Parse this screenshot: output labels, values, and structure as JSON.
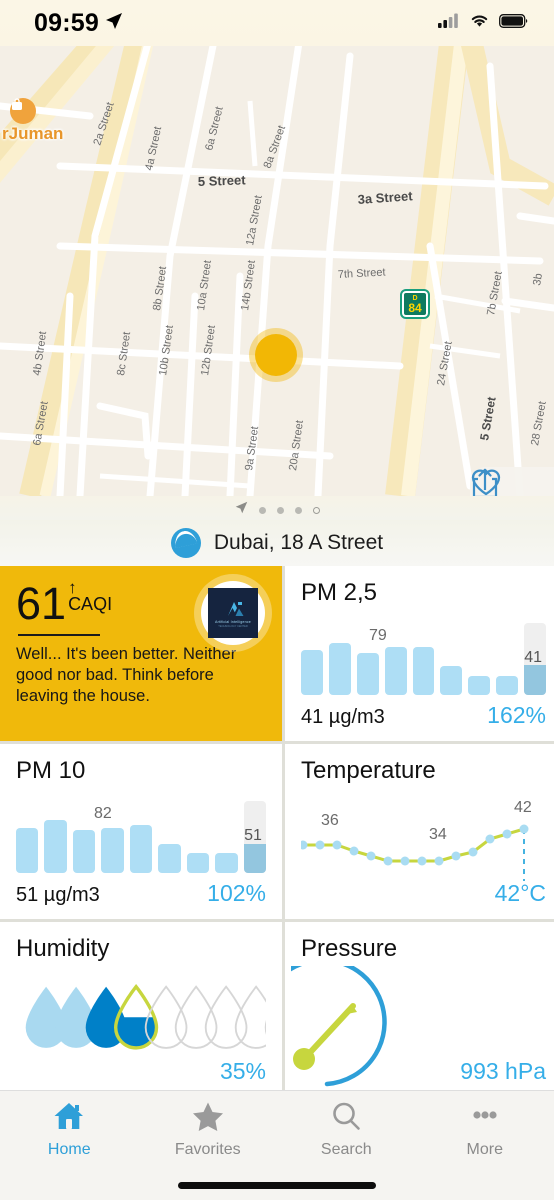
{
  "status_bar": {
    "time": "09:59",
    "location_arrow_icon": "location-arrow-icon",
    "signal_icon": "cellular-signal-icon",
    "wifi_icon": "wifi-icon",
    "battery_icon": "battery-full-icon"
  },
  "map": {
    "poi_label": "rJuman",
    "poi_icon": "shopping-bag-icon",
    "highway_shield": {
      "prefix": "D",
      "number": "84"
    },
    "street_labels": [
      "2a Street",
      "4a Street",
      "5 Street",
      "6a Street",
      "8a Street",
      "3a Street",
      "12a Street",
      "7th Street",
      "8b Street",
      "10a Street",
      "14b Street",
      "4b Street",
      "8c Street",
      "10b Street",
      "12b Street",
      "6a Street",
      "9a Street",
      "20a Street",
      "24 Street",
      "5 Street",
      "7b Street",
      "5 Street",
      "28 Street",
      "3b"
    ],
    "share_icon": "share-icon",
    "favorite_icon": "heart-icon",
    "marker_color": "#F2B705"
  },
  "pager": {
    "arrow_icon": "location-arrow-icon",
    "dots": [
      "filled",
      "filled",
      "filled",
      "hollow"
    ]
  },
  "location": {
    "icon": "air-quality-globe-icon",
    "name": "Dubai, 18 A Street"
  },
  "cards": {
    "caqi": {
      "value": "61",
      "trend_arrow": "↑",
      "unit_label": "CAQI",
      "message": "Well... It's been better. Neither good nor bad. Think before leaving the house.",
      "background_color": "#F0B90B",
      "avatar_name": "Artificial Intelligence",
      "avatar_sub": "TECHNOLOGY CENTER"
    },
    "pm25": {
      "title": "PM 2,5",
      "value": "41 µg/m3",
      "percent": "162%",
      "peak_label": "79",
      "current_label": "41"
    },
    "pm10": {
      "title": "PM 10",
      "value": "51 µg/m3",
      "percent": "102%",
      "peak_label": "82",
      "current_label": "51"
    },
    "temperature": {
      "title": "Temperature",
      "value": "42°C",
      "labels": [
        "36",
        "34",
        "42"
      ]
    },
    "humidity": {
      "title": "Humidity",
      "percent": "35%"
    },
    "pressure": {
      "title": "Pressure",
      "value": "993 hPa"
    }
  },
  "chart_data": [
    {
      "type": "bar",
      "title": "PM 2,5",
      "ylabel": "µg/m3",
      "values": [
        62,
        72,
        58,
        66,
        66,
        40,
        26,
        26,
        41
      ],
      "peak_value": 79,
      "current_value": 41,
      "ylim": [
        0,
        100
      ],
      "annotations": [
        "79",
        "41"
      ],
      "legend": "",
      "grid": false
    },
    {
      "type": "bar",
      "title": "PM 10",
      "ylabel": "µg/m3",
      "values": [
        62,
        74,
        60,
        62,
        66,
        40,
        28,
        28,
        51
      ],
      "peak_value": 82,
      "current_value": 51,
      "ylim": [
        0,
        100
      ],
      "annotations": [
        "82",
        "51"
      ],
      "legend": "",
      "grid": false
    },
    {
      "type": "line",
      "title": "Temperature",
      "ylabel": "°C",
      "values": [
        36,
        36,
        36,
        35,
        34.5,
        34,
        34,
        34,
        34,
        34.5,
        35.5,
        36,
        38,
        40,
        42
      ],
      "annotations": [
        "36",
        "34",
        "42"
      ],
      "current_value": 42,
      "ylim": [
        33,
        43
      ],
      "grid": false
    },
    {
      "type": "bar",
      "title": "Humidity",
      "ylabel": "%",
      "categories": [
        "1",
        "2",
        "3",
        "4",
        "5",
        "6",
        "7",
        "8",
        "9",
        "10"
      ],
      "values": [
        100,
        100,
        100,
        35,
        0,
        0,
        0,
        0,
        0,
        0
      ],
      "current_value": 35,
      "ylim": [
        0,
        100
      ],
      "grid": false
    },
    {
      "type": "gauge",
      "title": "Pressure",
      "ylabel": "hPa",
      "current_value": 993,
      "ylim": [
        950,
        1050
      ],
      "grid": false
    }
  ],
  "tabbar": {
    "items": [
      {
        "label": "Home",
        "icon": "home-icon",
        "active": true
      },
      {
        "label": "Favorites",
        "icon": "star-icon",
        "active": false
      },
      {
        "label": "Search",
        "icon": "search-icon",
        "active": false
      },
      {
        "label": "More",
        "icon": "ellipsis-icon",
        "active": false
      }
    ]
  }
}
